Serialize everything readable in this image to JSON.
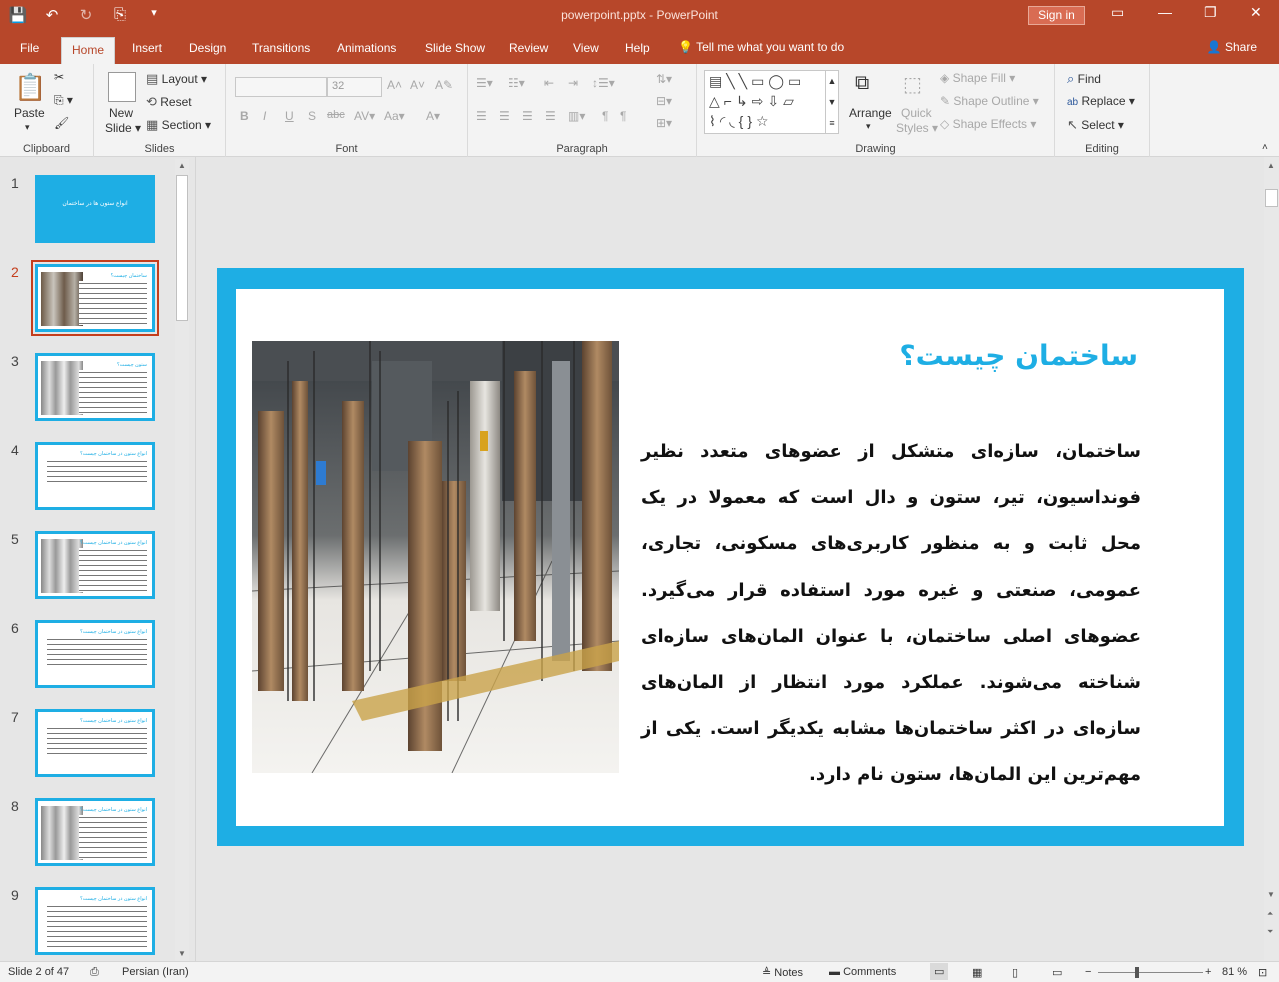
{
  "titlebar": {
    "title": "powerpoint.pptx  -  PowerPoint",
    "sign_in": "Sign in",
    "quick_access": [
      "💾",
      "↶",
      "↻",
      "⎘",
      "▾"
    ],
    "ribbon_display_icon": "▭",
    "minimize_icon": "—",
    "restore_icon": "❐",
    "close_icon": "✕"
  },
  "menu": {
    "tabs": [
      "File",
      "Home",
      "Insert",
      "Design",
      "Transitions",
      "Animations",
      "Slide Show",
      "Review",
      "View",
      "Help"
    ],
    "tell_me": "Tell me what you want to do",
    "share": "Share"
  },
  "ribbon": {
    "clipboard": {
      "label": "Clipboard",
      "paste": "Paste"
    },
    "slides": {
      "label": "Slides",
      "new_slide_1": "New",
      "new_slide_2": "Slide ▾",
      "layout": "Layout ▾",
      "reset": "Reset",
      "section": "Section ▾"
    },
    "font": {
      "label": "Font",
      "size": "32",
      "bold": "B",
      "italic": "I",
      "underline": "U",
      "shadow": "S",
      "strike": "abc"
    },
    "paragraph": {
      "label": "Paragraph"
    },
    "drawing": {
      "label": "Drawing",
      "arrange": "Arrange",
      "quick_styles_1": "Quick",
      "quick_styles_2": "Styles ▾",
      "shape_fill": "Shape Fill ▾",
      "shape_outline": "Shape Outline ▾",
      "shape_effects": "Shape Effects ▾"
    },
    "editing": {
      "label": "Editing",
      "find": "Find",
      "replace": "Replace ▾",
      "select": "Select ▾"
    }
  },
  "thumbnails": [
    {
      "num": "1",
      "title": "انواع ستون ها در ساختمان"
    },
    {
      "num": "2",
      "title": "ساختمان چیست؟"
    },
    {
      "num": "3",
      "title": "ستون چیست؟"
    },
    {
      "num": "4",
      "title": "انواع ستون در ساختمان چیست؟"
    },
    {
      "num": "5",
      "title": "انواع ستون در ساختمان چیست؟"
    },
    {
      "num": "6",
      "title": "انواع ستون در ساختمان چیست؟"
    },
    {
      "num": "7",
      "title": "انواع ستون در ساختمان چیست؟"
    },
    {
      "num": "8",
      "title": "انواع ستون در ساختمان چیست؟"
    },
    {
      "num": "9",
      "title": "انواع ستون در ساختمان چیست؟"
    }
  ],
  "slide": {
    "title": "ساختمان چیست؟",
    "body": "ساختمان، سازه‌ای متشکل از عضوهای متعدد نظیر فونداسیون، تیر، ستون و دال است که معمولا در یک محل ثابت و به منظور کاربری‌های مسکونی، تجاری، عمومی، صنعتی و غیره مورد استفاده قرار می‌گیرد. عضوهای اصلی ساختمان، با عنوان المان‌های سازه‌ای شناخته می‌شوند. عملکرد مورد انتظار از المان‌های سازه‌ای در اکثر ساختمان‌ها مشابه یکدیگر است. یکی از مهم‌ترین این المان‌ها، ستون نام دارد."
  },
  "status": {
    "slide_info": "Slide 2 of 47",
    "language": "Persian (Iran)",
    "notes": "Notes",
    "comments": "Comments",
    "zoom": "81 %"
  }
}
